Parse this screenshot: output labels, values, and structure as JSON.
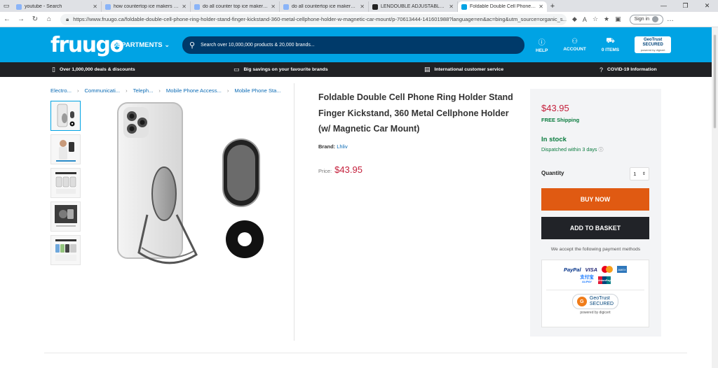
{
  "browser": {
    "tabs": [
      {
        "title": "youtube - Search",
        "color": "#8ab4f8"
      },
      {
        "title": "how countertop ice makers work",
        "color": "#8ab4f8"
      },
      {
        "title": "do all counter top ice makers use",
        "color": "#8ab4f8"
      },
      {
        "title": "do all countertop ice makers use",
        "color": "#8ab4f8"
      },
      {
        "title": "LENDOUBLE ADJUSTABLE RING",
        "color": "#222222"
      },
      {
        "title": "Foldable Double Cell Phone Ring",
        "color": "#00a3e4"
      }
    ],
    "url": "https://www.fruugo.ca/foldable-double-cell-phone-ring-holder-stand-finger-kickstand-360-metal-cellphone-holder-w-magnetic-car-mount/p-70613444-141601988?language=en&ac=bing&utm_source=organic_s...",
    "signin_label": "Sign in"
  },
  "header": {
    "logo": "fruugo",
    "departments": "DEPARTMENTS",
    "search_placeholder": "Search over 10,000,000 products & 20,000 brands...",
    "help": "HELP",
    "account": "ACCOUNT",
    "items": "0 ITEMS",
    "geotrust": "GeoTrust",
    "geotrust_secured": "SECURED",
    "geotrust_powered": "powered by digicert"
  },
  "promos": [
    {
      "text": "Over 1,000,000 deals & discounts",
      "icon": "bookmark-icon"
    },
    {
      "text": "Big savings on your favourite brands",
      "icon": "card-icon"
    },
    {
      "text": "International customer service",
      "icon": "chat-icon"
    },
    {
      "text": "COVID-19 Information",
      "icon": "question-icon"
    }
  ],
  "breadcrumbs": [
    "Electro...",
    "Communicati...",
    "Teleph...",
    "Mobile Phone Access...",
    "Mobile Phone Sta..."
  ],
  "product": {
    "title": "Foldable Double Cell Phone Ring Holder Stand Finger Kickstand, 360 Metal Cellphone Holder (w/ Magnetic Car Mount)",
    "brand_label": "Brand:",
    "brand_value": "Lhliv",
    "price_label": "Price:",
    "price": "$43.95"
  },
  "buybox": {
    "price": "$43.95",
    "shipping": "FREE Shipping",
    "stock": "In stock",
    "dispatch": "Dispatched within 3 days",
    "quantity_label": "Quantity",
    "quantity_value": "1",
    "buy_now": "BUY NOW",
    "add_to_basket": "ADD TO BASKET",
    "accept_text": "We accept the following payment methods",
    "payments": [
      "PayPal",
      "VISA",
      "支付宝",
      "ALIPAY",
      "UnionPay"
    ],
    "geotrust": "GeoTrust",
    "geotrust_secured": "SECURED",
    "geotrust_powered": "powered by digicert"
  },
  "colors": {
    "brand_blue": "#00a3e4",
    "search_navy": "#003a6a",
    "price_red": "#c41e3a",
    "stock_green": "#0a7b3e",
    "buy_orange": "#e05a12",
    "basket_dark": "#212328"
  }
}
